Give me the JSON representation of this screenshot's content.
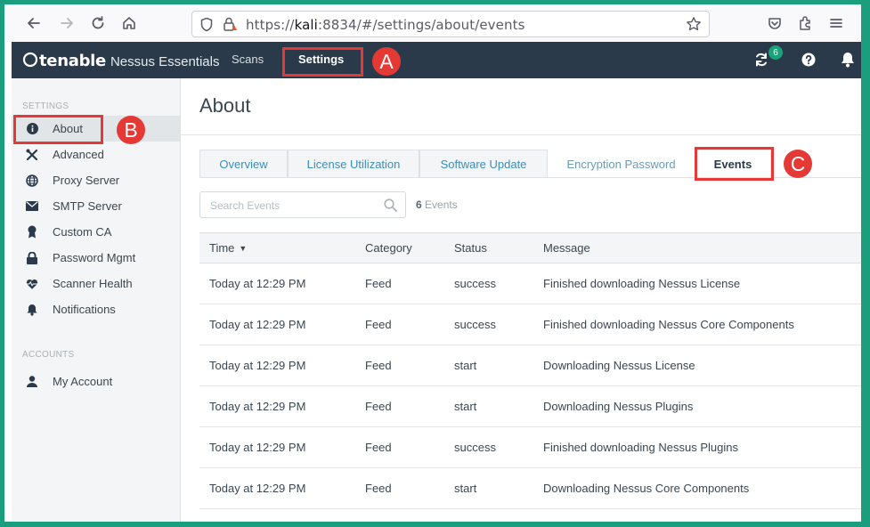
{
  "browser": {
    "url_host": "kali",
    "url_prefix": "https://",
    "url_rest": ":8834/#/settings/about/events"
  },
  "header": {
    "brand": "tenable",
    "product": "Nessus Essentials",
    "nav": {
      "scans": "Scans",
      "settings": "Settings"
    },
    "sync_badge": "6"
  },
  "markers": {
    "a": "A",
    "b": "B",
    "c": "C"
  },
  "sidebar": {
    "settings_heading": "SETTINGS",
    "items": [
      {
        "label": "About",
        "icon": "info-icon"
      },
      {
        "label": "Advanced",
        "icon": "tools-icon"
      },
      {
        "label": "Proxy Server",
        "icon": "globe-icon"
      },
      {
        "label": "SMTP Server",
        "icon": "envelope-icon"
      },
      {
        "label": "Custom CA",
        "icon": "certificate-icon"
      },
      {
        "label": "Password Mgmt",
        "icon": "lock-icon"
      },
      {
        "label": "Scanner Health",
        "icon": "heartbeat-icon"
      },
      {
        "label": "Notifications",
        "icon": "bell-icon"
      }
    ],
    "accounts_heading": "ACCOUNTS",
    "account_items": [
      {
        "label": "My Account",
        "icon": "user-icon"
      }
    ]
  },
  "main": {
    "title": "About",
    "tabs": [
      {
        "label": "Overview"
      },
      {
        "label": "License Utilization"
      },
      {
        "label": "Software Update"
      },
      {
        "label": "Encryption Password"
      },
      {
        "label": "Events"
      }
    ],
    "search_placeholder": "Search Events",
    "event_count": "6",
    "event_count_label": "Events",
    "columns": {
      "time": "Time",
      "sort_indicator": "▼",
      "category": "Category",
      "status": "Status",
      "message": "Message"
    },
    "rows": [
      {
        "time": "Today at 12:29 PM",
        "category": "Feed",
        "status": "success",
        "message": "Finished downloading Nessus License"
      },
      {
        "time": "Today at 12:29 PM",
        "category": "Feed",
        "status": "success",
        "message": "Finished downloading Nessus Core Components"
      },
      {
        "time": "Today at 12:29 PM",
        "category": "Feed",
        "status": "start",
        "message": "Downloading Nessus License"
      },
      {
        "time": "Today at 12:29 PM",
        "category": "Feed",
        "status": "start",
        "message": "Downloading Nessus Plugins"
      },
      {
        "time": "Today at 12:29 PM",
        "category": "Feed",
        "status": "success",
        "message": "Finished downloading Nessus Plugins"
      },
      {
        "time": "Today at 12:29 PM",
        "category": "Feed",
        "status": "start",
        "message": "Downloading Nessus Core Components"
      }
    ]
  },
  "colors": {
    "header_bg": "#2b3a4a",
    "accent": "#3c8dbc",
    "highlight": "#e53935",
    "frame": "#1b9e7e",
    "badge": "#1aa37a"
  }
}
